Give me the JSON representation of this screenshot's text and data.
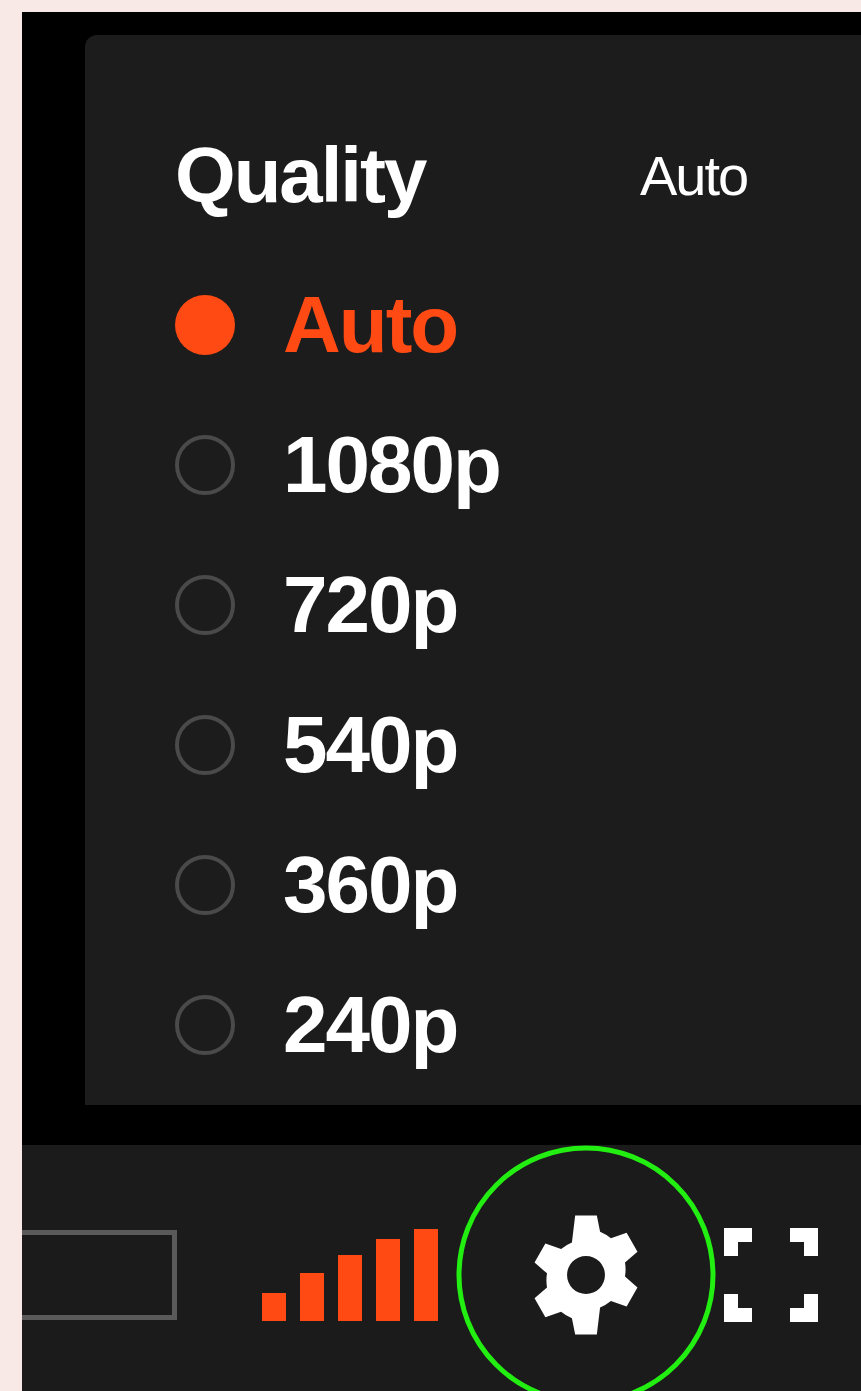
{
  "menu": {
    "title": "Quality",
    "current": "Auto",
    "options": [
      {
        "label": "Auto",
        "selected": true
      },
      {
        "label": "1080p",
        "selected": false
      },
      {
        "label": "720p",
        "selected": false
      },
      {
        "label": "540p",
        "selected": false
      },
      {
        "label": "360p",
        "selected": false
      },
      {
        "label": "240p",
        "selected": false
      }
    ]
  }
}
